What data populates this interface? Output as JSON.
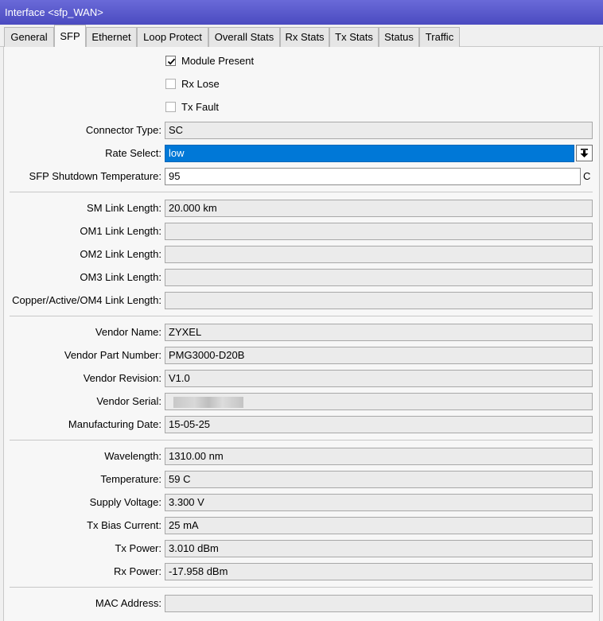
{
  "window": {
    "title": "Interface <sfp_WAN>"
  },
  "tabs": [
    {
      "label": "General"
    },
    {
      "label": "SFP"
    },
    {
      "label": "Ethernet"
    },
    {
      "label": "Loop Protect"
    },
    {
      "label": "Overall Stats"
    },
    {
      "label": "Rx Stats"
    },
    {
      "label": "Tx Stats"
    },
    {
      "label": "Status"
    },
    {
      "label": "Traffic"
    }
  ],
  "active_tab": "SFP",
  "checkboxes": {
    "module_present": {
      "label": "Module Present",
      "checked": true
    },
    "rx_lose": {
      "label": "Rx Lose",
      "checked": false
    },
    "tx_fault": {
      "label": "Tx Fault",
      "checked": false
    }
  },
  "fields": {
    "connector_type": {
      "label": "Connector Type:",
      "value": "SC"
    },
    "rate_select": {
      "label": "Rate Select:",
      "value": "low"
    },
    "shutdown_temp": {
      "label": "SFP Shutdown Temperature:",
      "value": "95",
      "unit": "C"
    },
    "sm_link": {
      "label": "SM Link Length:",
      "value": "20.000 km"
    },
    "om1_link": {
      "label": "OM1 Link Length:",
      "value": ""
    },
    "om2_link": {
      "label": "OM2 Link Length:",
      "value": ""
    },
    "om3_link": {
      "label": "OM3 Link Length:",
      "value": ""
    },
    "copper_link": {
      "label": "Copper/Active/OM4 Link Length:",
      "value": ""
    },
    "vendor_name": {
      "label": "Vendor Name:",
      "value": "ZYXEL"
    },
    "vendor_part": {
      "label": "Vendor Part Number:",
      "value": "PMG3000-D20B"
    },
    "vendor_rev": {
      "label": "Vendor Revision:",
      "value": "V1.0"
    },
    "vendor_serial": {
      "label": "Vendor Serial:",
      "value": ""
    },
    "mfg_date": {
      "label": "Manufacturing Date:",
      "value": "15-05-25"
    },
    "wavelength": {
      "label": "Wavelength:",
      "value": "1310.00 nm"
    },
    "temperature": {
      "label": "Temperature:",
      "value": "59 C"
    },
    "supply_voltage": {
      "label": "Supply Voltage:",
      "value": "3.300 V"
    },
    "tx_bias": {
      "label": "Tx Bias Current:",
      "value": "25 mA"
    },
    "tx_power": {
      "label": "Tx Power:",
      "value": "3.010 dBm"
    },
    "rx_power": {
      "label": "Rx Power:",
      "value": "-17.958 dBm"
    },
    "mac_address": {
      "label": "MAC Address:",
      "value": ""
    }
  },
  "colors": {
    "titlebar": "#5555cc",
    "selection": "#0078d7"
  },
  "icons": {
    "checkmark": "check-icon",
    "dropdown": "arrow-down-bar-icon"
  }
}
